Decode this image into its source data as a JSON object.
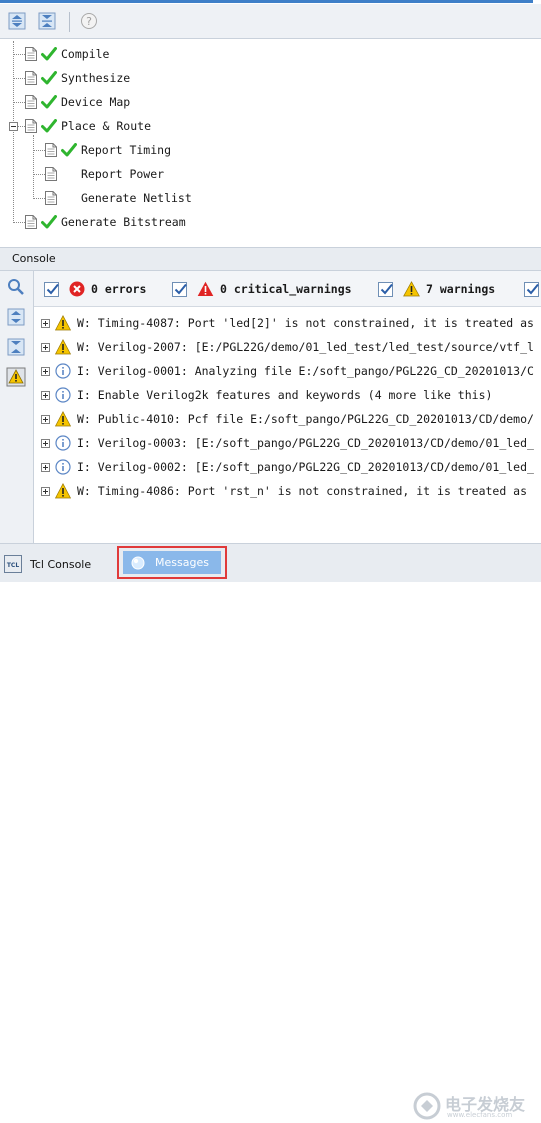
{
  "flow": {
    "items": [
      {
        "label": "Compile",
        "done": true
      },
      {
        "label": "Synthesize",
        "done": true
      },
      {
        "label": "Device Map",
        "done": true
      },
      {
        "label": "Place & Route",
        "done": true
      },
      {
        "label": "Report Timing",
        "done": true
      },
      {
        "label": "Report Power",
        "done": false
      },
      {
        "label": "Generate Netlist",
        "done": false
      },
      {
        "label": "Generate Bitstream",
        "done": true
      }
    ]
  },
  "console": {
    "title": "Console",
    "filters": {
      "errors": "0 errors",
      "critical": "0 critical_warnings",
      "warnings": "7 warnings"
    },
    "messages": [
      {
        "type": "warning",
        "text": "W: Timing-4087: Port 'led[2]' is not constrained, it is treated as"
      },
      {
        "type": "warning",
        "text": "W: Verilog-2007: [E:/PGL22G/demo/01_led_test/led_test/source/vtf_l"
      },
      {
        "type": "info",
        "text": "I: Verilog-0001: Analyzing file E:/soft_pango/PGL22G_CD_20201013/C"
      },
      {
        "type": "info",
        "text": "I: Enable Verilog2k features and keywords (4 more like this)"
      },
      {
        "type": "warning",
        "text": "W: Public-4010: Pcf file E:/soft_pango/PGL22G_CD_20201013/CD/demo/"
      },
      {
        "type": "info",
        "text": "I: Verilog-0003: [E:/soft_pango/PGL22G_CD_20201013/CD/demo/01_led_"
      },
      {
        "type": "info",
        "text": "I: Verilog-0002: [E:/soft_pango/PGL22G_CD_20201013/CD/demo/01_led_"
      },
      {
        "type": "warning",
        "text": "W: Timing-4086: Port 'rst_n' is not constrained, it is treated as"
      }
    ]
  },
  "tabs": {
    "tcl": "Tcl Console",
    "tcl_icon_text": "TCL",
    "messages": "Messages"
  },
  "watermark": {
    "line1": "电子发烧友",
    "line2": "www.elecfans.com"
  },
  "colors": {
    "accent": "#3e7fc8",
    "check": "#2fb52f",
    "error": "#e02424",
    "warning": "#f5c400",
    "info": "#5b86c5",
    "highlight": "#e03a3a"
  }
}
